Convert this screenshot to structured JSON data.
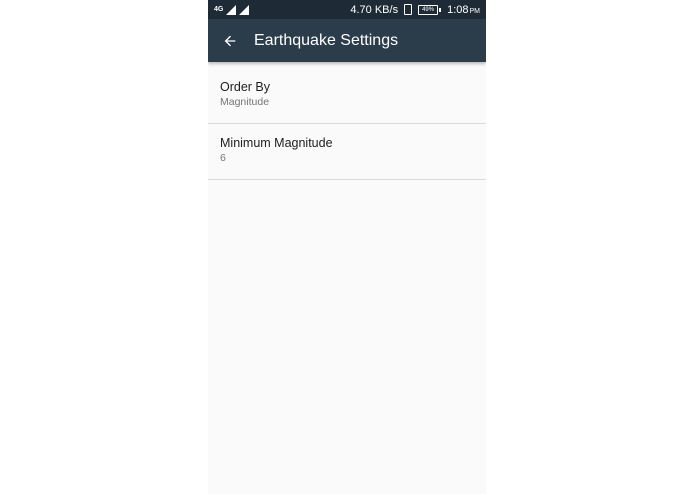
{
  "status_bar": {
    "network_type": "4G",
    "network_speed": "4.70 KB/s",
    "battery_level": "49%",
    "time": "1:08",
    "time_suffix": "PM"
  },
  "app_bar": {
    "title": "Earthquake Settings",
    "back_icon": "arrow-back-icon"
  },
  "preferences": [
    {
      "title": "Order By",
      "summary": "Magnitude"
    },
    {
      "title": "Minimum Magnitude",
      "summary": "6"
    }
  ],
  "colors": {
    "status_bar": "#1e2b36",
    "app_bar": "#2b3c4b",
    "background": "#fafafa",
    "divider": "#dcdcdc"
  }
}
